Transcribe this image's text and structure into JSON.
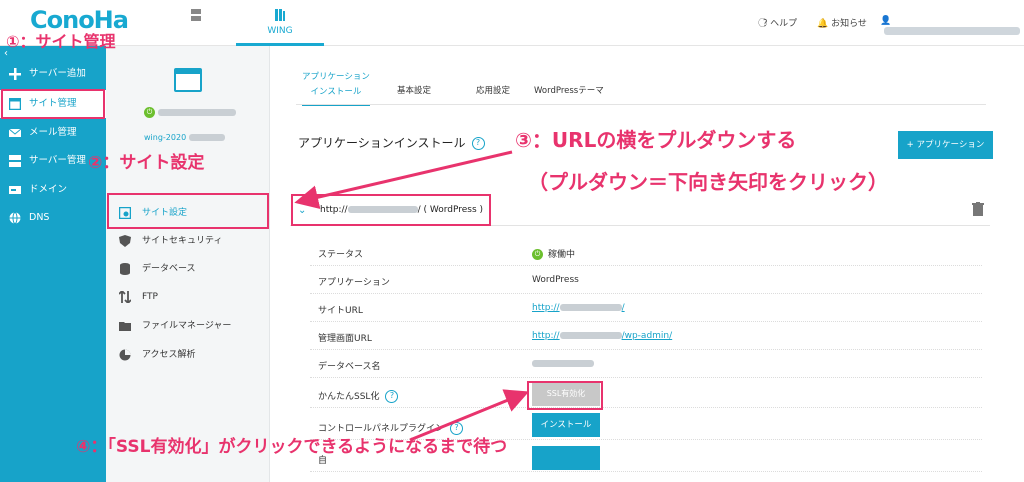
{
  "header": {
    "logo": "ConoHa",
    "tabs": [
      {
        "label": "",
        "icon": "server-icon"
      },
      {
        "label": "WING",
        "icon": "wing-icon"
      }
    ],
    "help": "ヘルプ",
    "notice": "お知らせ"
  },
  "sidebar": {
    "collapse": "‹",
    "items": [
      {
        "label": "サーバー追加",
        "icon": "plus-icon"
      },
      {
        "label": "サイト管理",
        "icon": "window-icon"
      },
      {
        "label": "メール管理",
        "icon": "mail-icon"
      },
      {
        "label": "サーバー管理",
        "icon": "server-icon"
      },
      {
        "label": "ドメイン",
        "icon": "domain-icon"
      },
      {
        "label": "DNS",
        "icon": "globe-icon"
      }
    ]
  },
  "site": {
    "wing_name": "wing-2020"
  },
  "subnav": {
    "items": [
      {
        "label": "サイト設定",
        "icon": "site-settings-icon"
      },
      {
        "label": "サイトセキュリティ",
        "icon": "shield-icon"
      },
      {
        "label": "データベース",
        "icon": "database-icon"
      },
      {
        "label": "FTP",
        "icon": "ftp-icon"
      },
      {
        "label": "ファイルマネージャー",
        "icon": "folder-icon"
      },
      {
        "label": "アクセス解析",
        "icon": "pie-icon"
      }
    ]
  },
  "main": {
    "tabs": [
      {
        "label_line1": "アプリケーション",
        "label_line2": "インストール"
      },
      {
        "label_line1": "基本設定",
        "label_line2": ""
      },
      {
        "label_line1": "応用設定",
        "label_line2": ""
      },
      {
        "label_line1": "WordPressテーマ",
        "label_line2": ""
      }
    ],
    "section_title": "アプリケーションインストール",
    "app_button": "+ アプリケーション",
    "url_prefix": "http://",
    "url_suffix": "/ ( WordPress )",
    "rows": [
      {
        "label": "ステータス",
        "value": "稼働中"
      },
      {
        "label": "アプリケーション",
        "value": "WordPress"
      },
      {
        "label": "サイトURL",
        "value": "http://"
      },
      {
        "label": "管理画面URL",
        "value": "http://",
        "value_suffix": "/wp-admin/"
      },
      {
        "label": "データベース名",
        "value": ""
      },
      {
        "label": "かんたんSSL化",
        "value": ""
      },
      {
        "label": "コントロールパネルプラグイン",
        "value": ""
      },
      {
        "label": "自",
        "value": ""
      }
    ],
    "ssl_button": "SSL有効化",
    "install_button": "インストール"
  },
  "annotations": {
    "step1": "①：サイト管理",
    "step2": "②：サイト設定",
    "step3": "③：URLの横をプルダウンする",
    "step3b": "（プルダウン＝下向き矢印をクリック）",
    "step4": "④：「SSL有効化」がクリックできるようになるまで待つ"
  },
  "colors": {
    "accent": "#17a3c9",
    "annotation": "#e8336d",
    "status_green": "#6cbf2e"
  }
}
